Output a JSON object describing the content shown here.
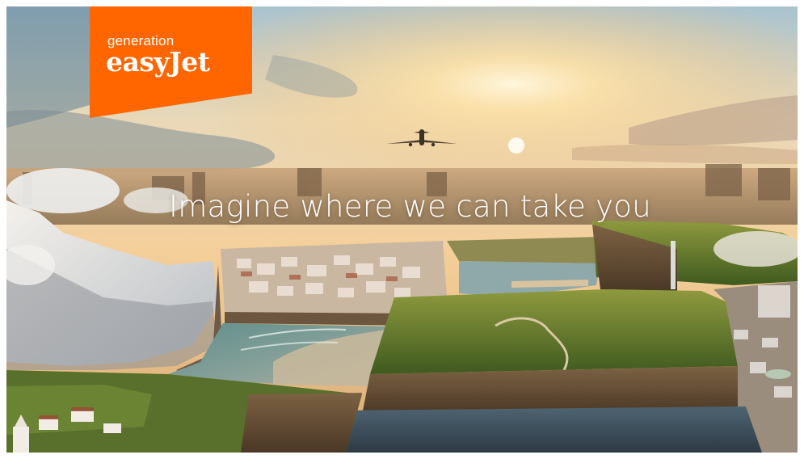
{
  "brand": {
    "line1": "generation",
    "line2": "easyJet",
    "color": "#ff6600"
  },
  "tagline": "Imagine where we can take you",
  "icons": [
    "airplane-icon",
    "sun-icon"
  ]
}
